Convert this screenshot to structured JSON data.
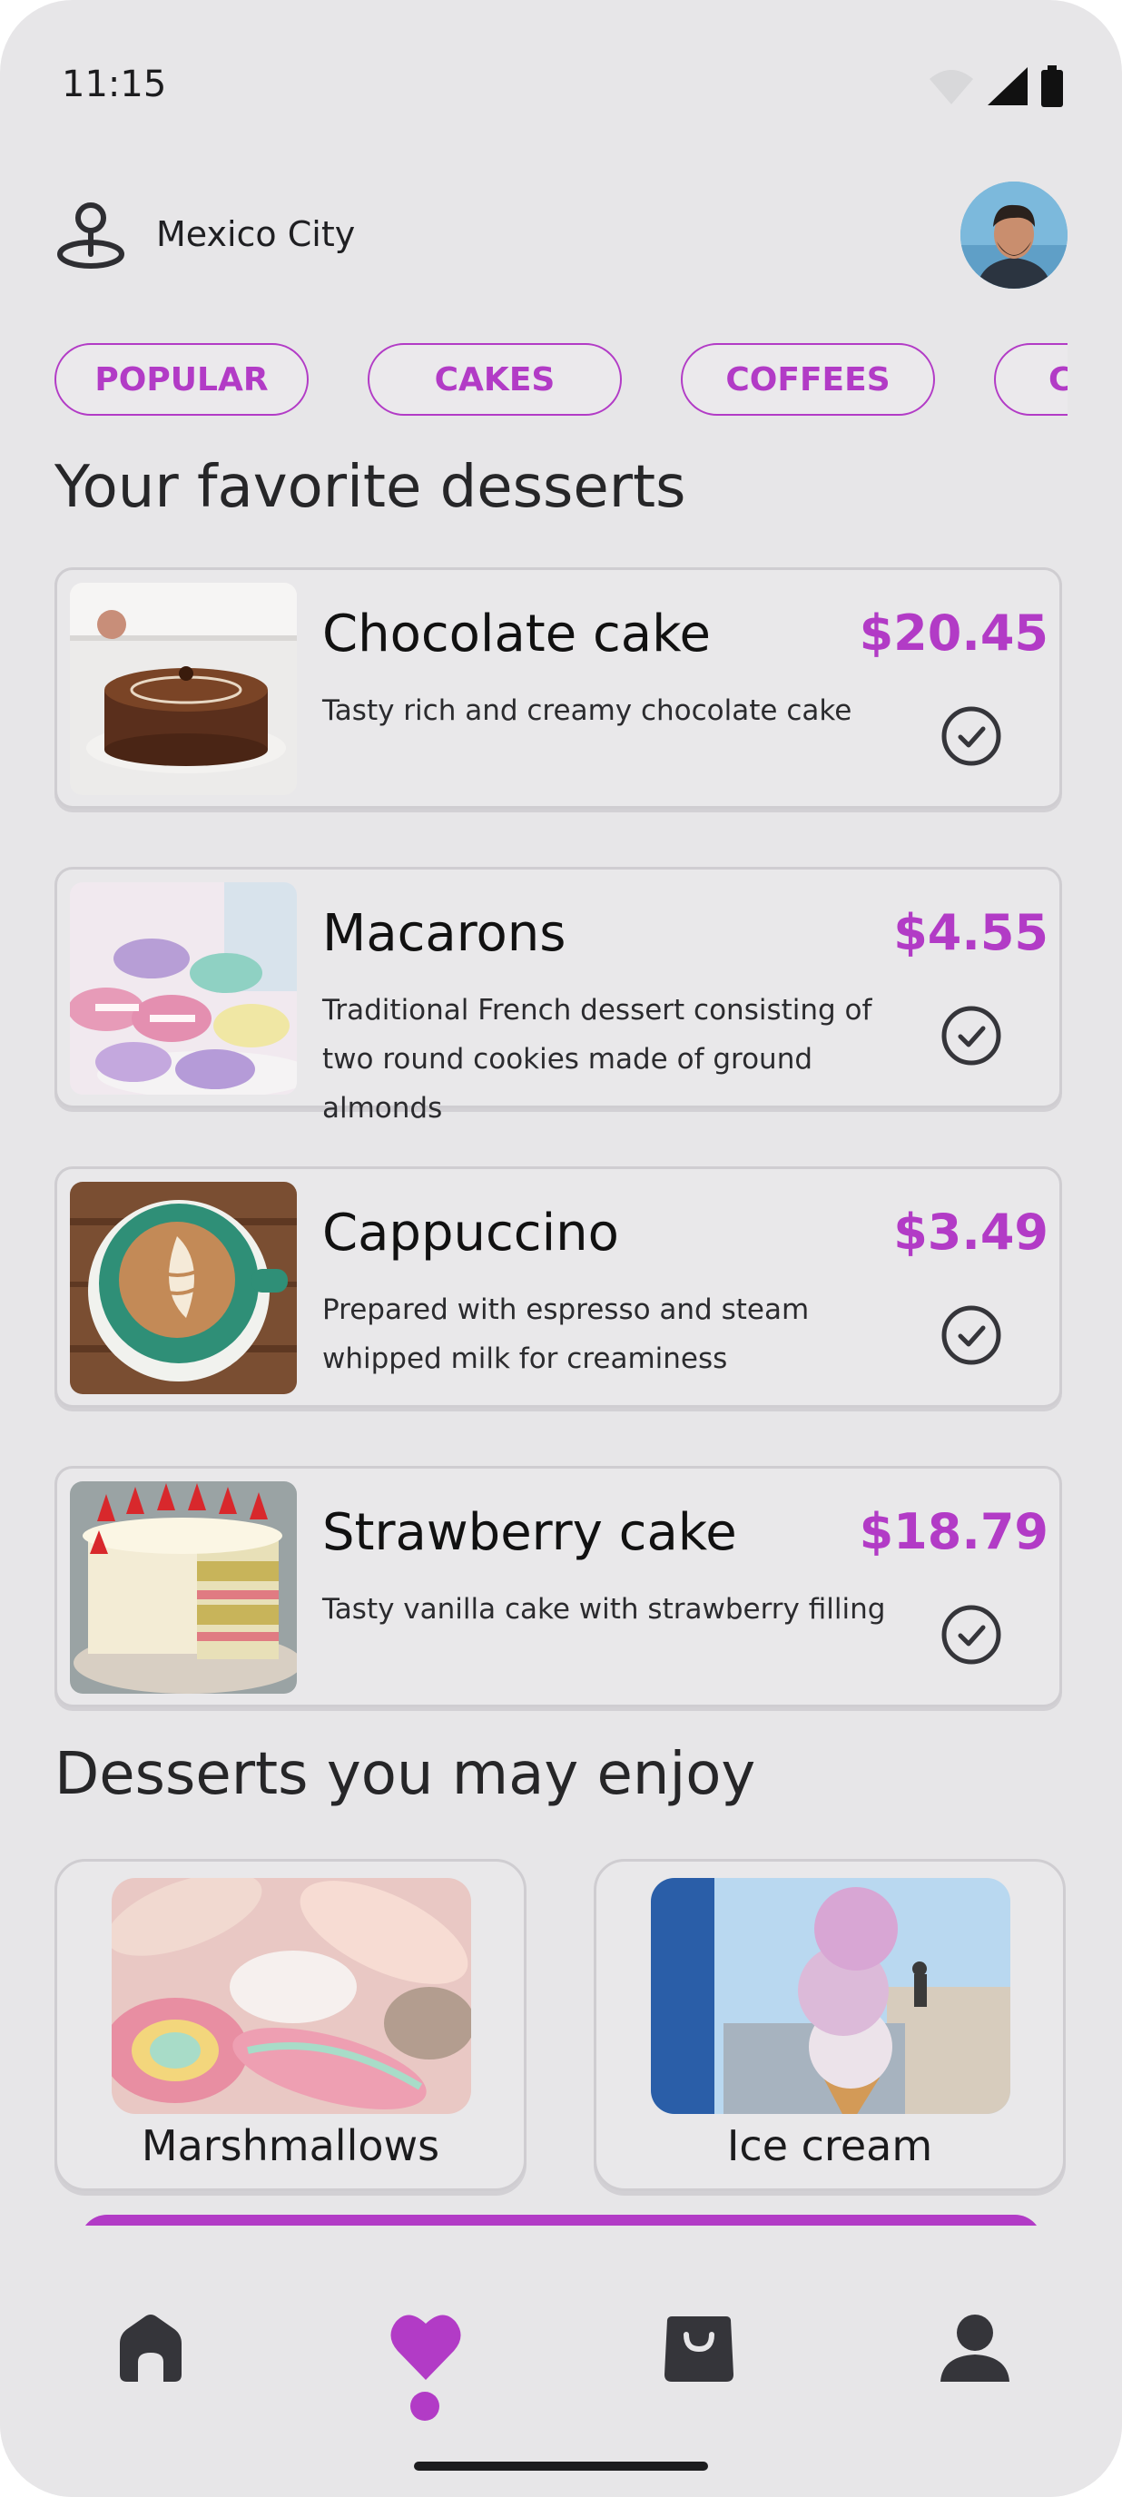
{
  "status_bar": {
    "time": "11:15"
  },
  "location": {
    "city": "Mexico City"
  },
  "categories": [
    "POPULAR",
    "CAKES",
    "COFFEES",
    "C"
  ],
  "sections": {
    "favorites_title": "Your favorite desserts",
    "enjoy_title": "Desserts you may enjoy"
  },
  "favorites": [
    {
      "name": "Chocolate cake",
      "description": "Tasty rich and creamy chocolate cake",
      "price": "$20.45"
    },
    {
      "name": "Macarons",
      "description": "Traditional French dessert consisting of two round cookies made of ground almonds",
      "price": "$4.55"
    },
    {
      "name": "Cappuccino",
      "description": "Prepared with espresso and steam whipped milk for creaminess",
      "price": "$3.49"
    },
    {
      "name": "Strawberry cake",
      "description": "Tasty vanilla cake with strawberry filling",
      "price": "$18.79"
    }
  ],
  "recommendations": [
    {
      "name": "Marshmallows"
    },
    {
      "name": "Ice cream"
    }
  ],
  "nav": {
    "items": [
      "home-icon",
      "heart-icon",
      "bag-icon",
      "profile-icon"
    ],
    "active": "heart-icon"
  },
  "colors": {
    "accent": "#b23bc6",
    "background": "#e7e6e8",
    "text": "#262628"
  }
}
